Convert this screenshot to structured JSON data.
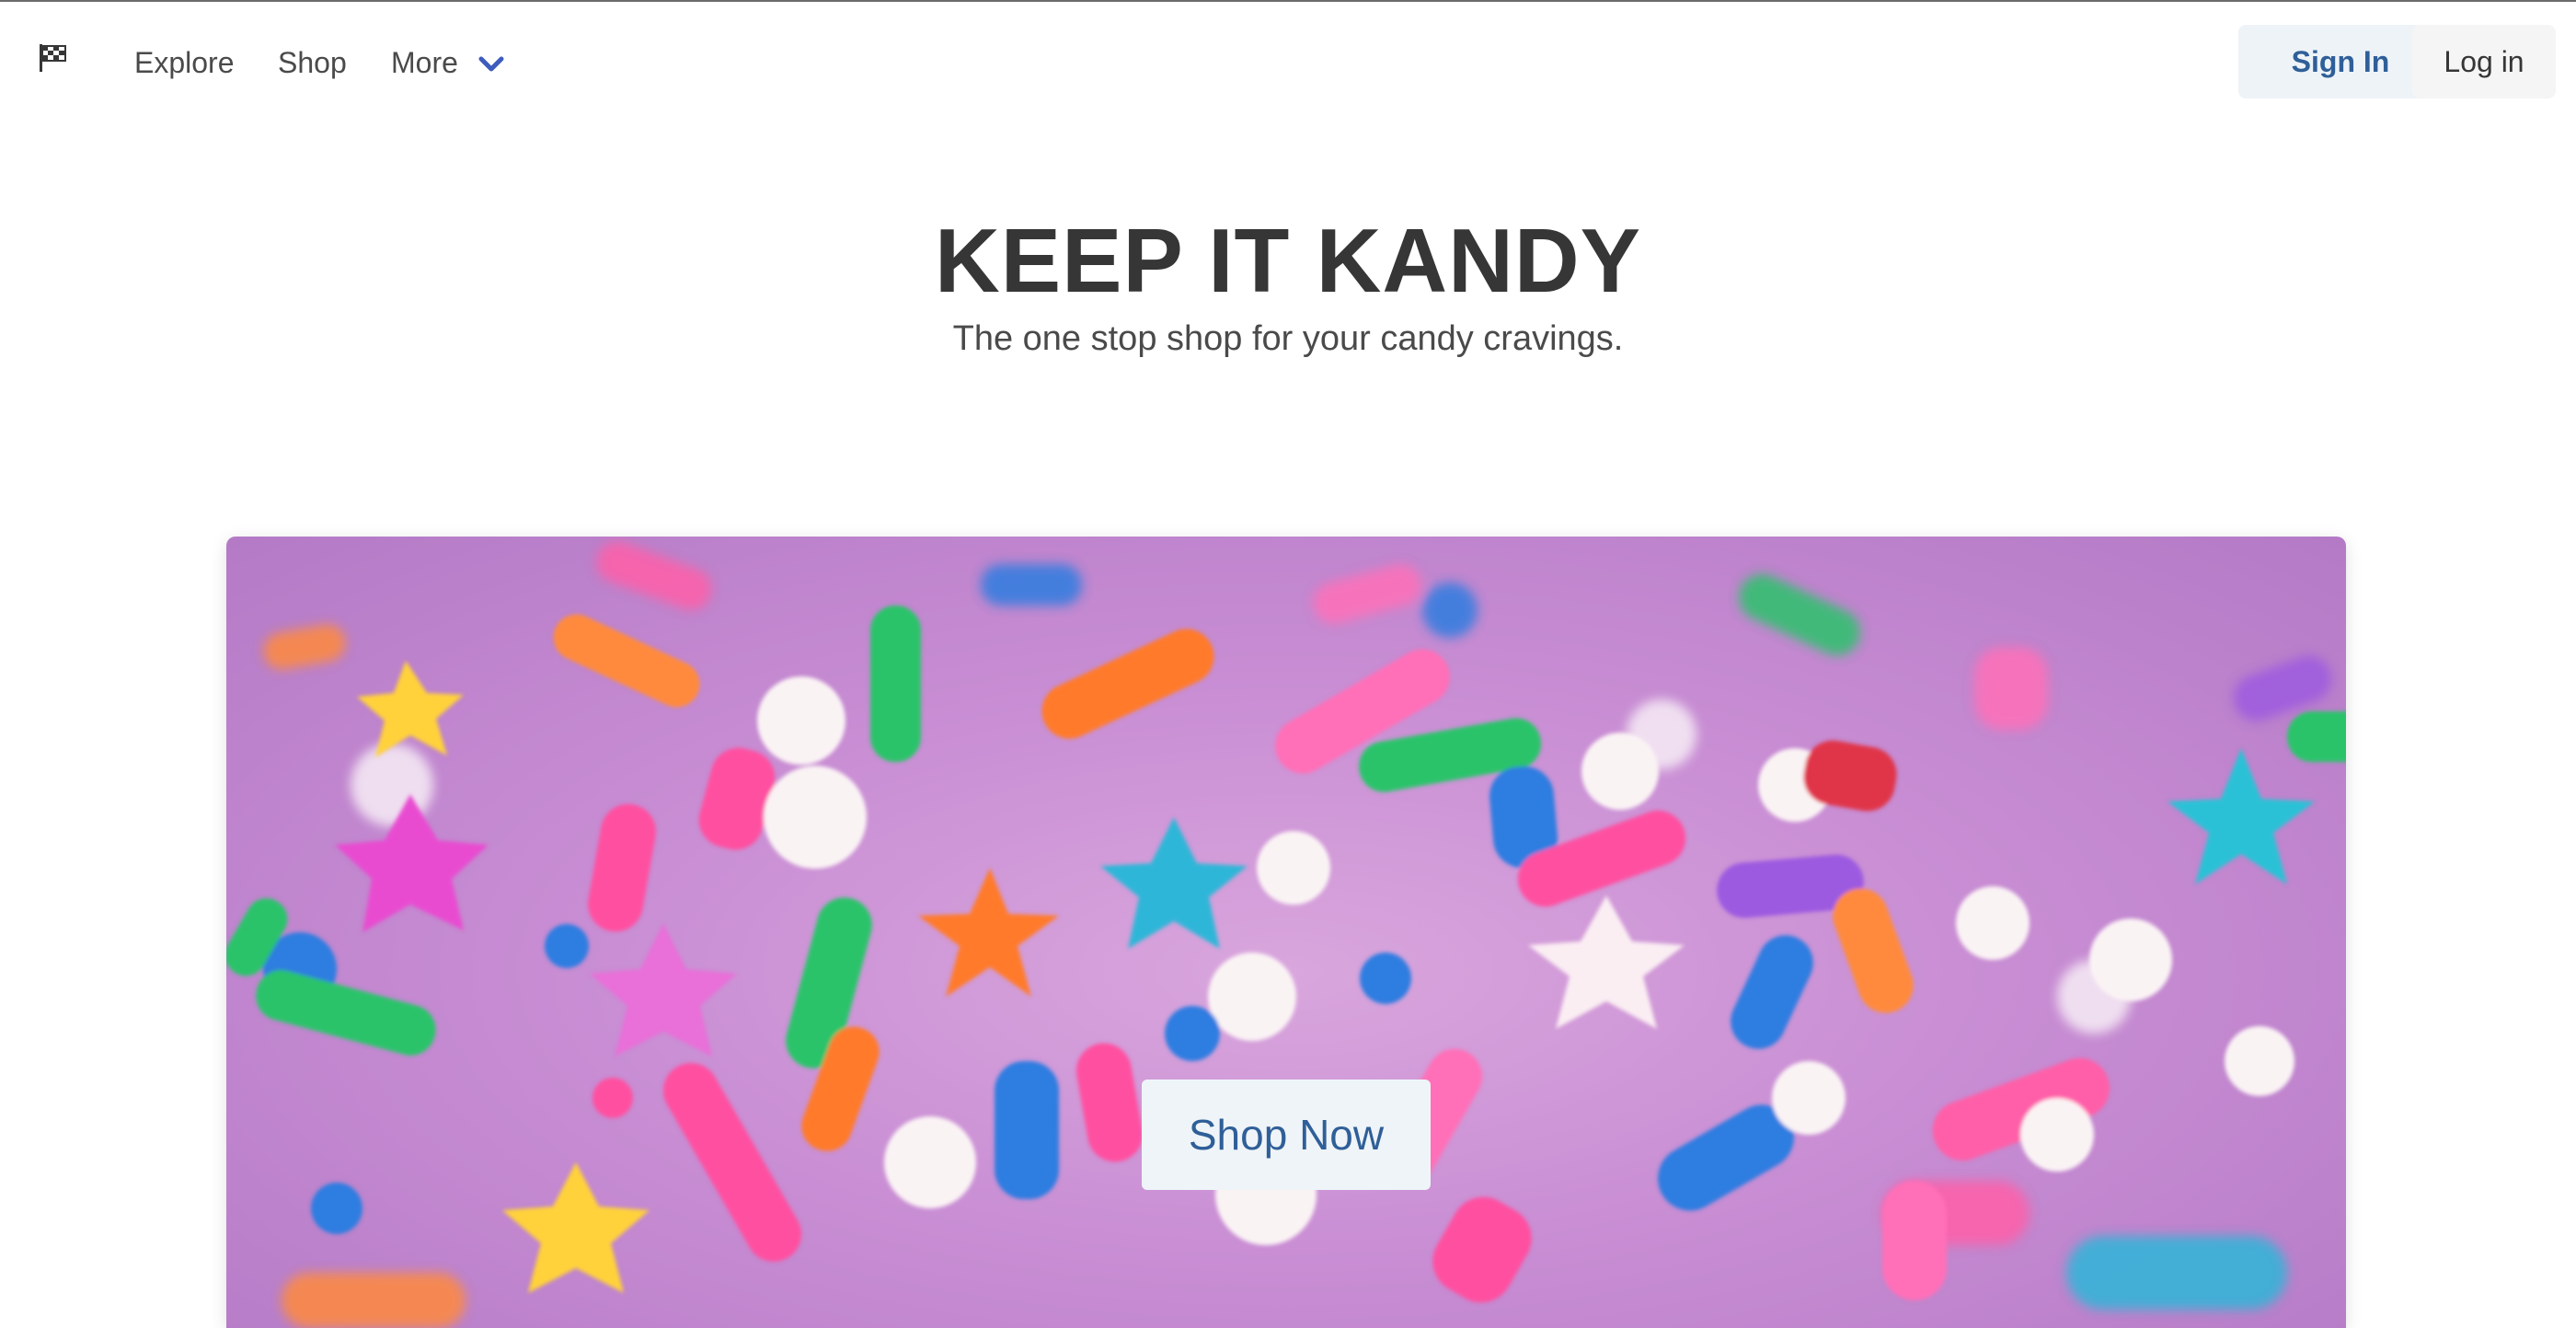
{
  "nav": {
    "logo_icon": "checkered-flag-icon",
    "links": [
      "Explore",
      "Shop",
      "More"
    ],
    "more_icon": "chevron-down-icon",
    "sign_in_label": "Sign In",
    "log_in_label": "Log in"
  },
  "hero": {
    "title": "KEEP IT KANDY",
    "subtitle": "The one stop shop for your candy cravings."
  },
  "banner": {
    "image": "colorful candy sprinkles on pink frosting",
    "cta_label": "Shop Now"
  },
  "colors": {
    "accent": "#2f5f98",
    "chevron": "#3e5bbd",
    "sign_in_bg": "#eef3f8",
    "log_in_bg": "#f5f5f5",
    "frosting": "#c98ed4"
  }
}
